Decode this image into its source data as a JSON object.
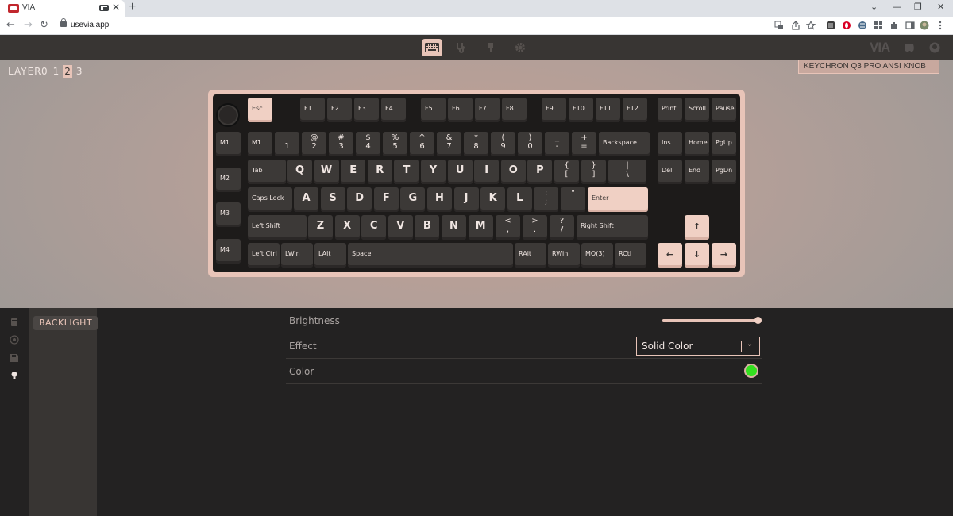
{
  "browser": {
    "tab_title": "VIA",
    "tab_close": "✕",
    "new_tab": "+",
    "win_min": "—",
    "win_restore": "❐",
    "win_close": "✕",
    "url": "usevia.app",
    "back": "←",
    "forward": "→",
    "reload": "↻"
  },
  "app": {
    "header_tabs": [
      {
        "icon": "keyboard-icon",
        "active": true
      },
      {
        "icon": "stethoscope-icon",
        "active": false
      },
      {
        "icon": "design-icon",
        "active": false
      },
      {
        "icon": "gear-icon",
        "active": false
      }
    ],
    "logo": "VIA"
  },
  "configure": {
    "layer_label": "LAYER",
    "layers": [
      "0",
      "1",
      "2",
      "3"
    ],
    "active_layer": "2",
    "keyboard_name": "KEYCHRON Q3 PRO ANSI KNOB"
  },
  "keys": {
    "row0": [
      "Esc",
      "F1",
      "F2",
      "F3",
      "F4",
      "F5",
      "F6",
      "F7",
      "F8",
      "F9",
      "F10",
      "F11",
      "F12",
      "Print",
      "Scroll",
      "Pause"
    ],
    "macros": [
      "M1",
      "M2",
      "M3",
      "M4"
    ],
    "row1": [
      {
        "t": "",
        "b": "",
        "l": "M1"
      },
      {
        "t": "!",
        "b": "1"
      },
      {
        "t": "@",
        "b": "2"
      },
      {
        "t": "#",
        "b": "3"
      },
      {
        "t": "$",
        "b": "4"
      },
      {
        "t": "%",
        "b": "5"
      },
      {
        "t": "^",
        "b": "6"
      },
      {
        "t": "&",
        "b": "7"
      },
      {
        "t": "*",
        "b": "8"
      },
      {
        "t": "(",
        "b": "9"
      },
      {
        "t": ")",
        "b": "0"
      },
      {
        "t": "_",
        "b": "-"
      },
      {
        "t": "+",
        "b": "="
      },
      {
        "l": "Backspace"
      },
      {
        "l": "Ins"
      },
      {
        "l": "Home"
      },
      {
        "l": "PgUp"
      }
    ],
    "row2": [
      "Tab",
      "Q",
      "W",
      "E",
      "R",
      "T",
      "Y",
      "U",
      "I",
      "O",
      "P",
      "Del",
      "End",
      "PgDn"
    ],
    "row2_sym": [
      {
        "t": "{",
        "b": "["
      },
      {
        "t": "}",
        "b": "]"
      },
      {
        "t": "|",
        "b": "\\"
      }
    ],
    "row3": [
      "Caps Lock",
      "A",
      "S",
      "D",
      "F",
      "G",
      "H",
      "J",
      "K",
      "L",
      "Enter"
    ],
    "row3_sym": [
      {
        "t": ":",
        "b": ";"
      },
      {
        "t": "\"",
        "b": "'"
      }
    ],
    "row4": [
      "Left Shift",
      "Z",
      "X",
      "C",
      "V",
      "B",
      "N",
      "M",
      "Right Shift"
    ],
    "row4_sym": [
      {
        "t": "<",
        "b": ","
      },
      {
        "t": ">",
        "b": "."
      },
      {
        "t": "?",
        "b": "/"
      }
    ],
    "row5": [
      "Left Ctrl",
      "LWin",
      "LAlt",
      "Space",
      "RAlt",
      "RWin",
      "MO(3)",
      "RCtl"
    ],
    "arrows": {
      "up": "↑",
      "left": "←",
      "down": "↓",
      "right": "→"
    }
  },
  "lighting": {
    "menu_item": "BACKLIGHT",
    "brightness_label": "Brightness",
    "brightness_value": 1.0,
    "effect_label": "Effect",
    "effect_value": "Solid Color",
    "effect_chevron": "⌄",
    "color_label": "Color",
    "color_value": "#33e01f"
  },
  "colors": {
    "accent": "#e8c4b8",
    "key_dark": "#3c3937",
    "key_light": "#f0d0c4",
    "case": "#1d1b1a"
  }
}
